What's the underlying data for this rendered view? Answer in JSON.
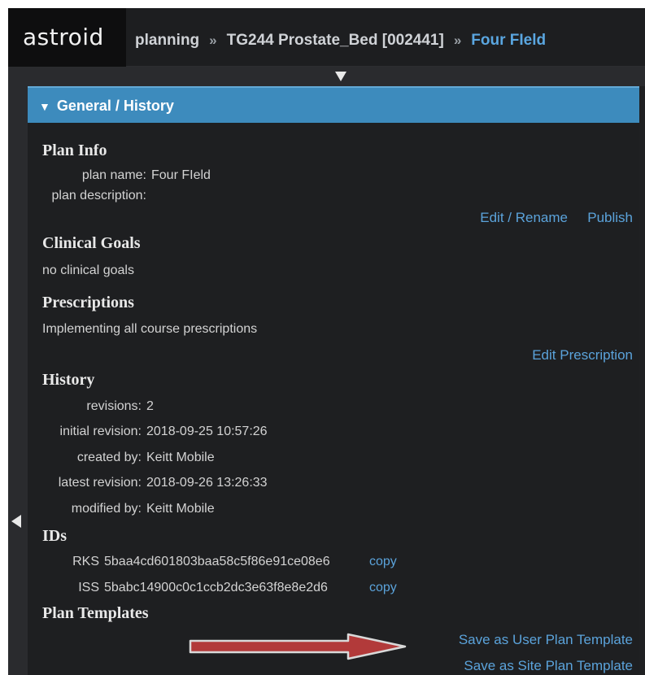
{
  "app": {
    "logo": "astroid"
  },
  "breadcrumb": {
    "items": [
      "planning",
      "TG244 Prostate_Bed [002441]",
      "Four FIeld"
    ],
    "separator": "»"
  },
  "panel": {
    "title": "General / History",
    "plan_info": {
      "heading": "Plan Info",
      "plan_name_label": "plan name:",
      "plan_name_value": "Four FIeld",
      "plan_description_label": "plan description:",
      "edit_rename": "Edit / Rename",
      "publish": "Publish"
    },
    "clinical_goals": {
      "heading": "Clinical Goals",
      "text": "no clinical goals"
    },
    "prescriptions": {
      "heading": "Prescriptions",
      "text": "Implementing all course prescriptions",
      "edit_prescription": "Edit Prescription"
    },
    "history": {
      "heading": "History",
      "revisions_label": "revisions:",
      "revisions_value": "2",
      "initial_label": "initial revision:",
      "initial_value": "2018-09-25 10:57:26",
      "created_label": "created by:",
      "created_value": "Keitt Mobile",
      "latest_label": "latest revision:",
      "latest_value": "2018-09-26 13:26:33",
      "modified_label": "modified by:",
      "modified_value": "Keitt Mobile"
    },
    "ids": {
      "heading": "IDs",
      "rks_label": "RKS",
      "rks_value": "5baa4cd601803baa58c5f86e91ce08e6",
      "iss_label": "ISS",
      "iss_value": "5babc14900c0c1ccb2dc3e63f8e8e2d6",
      "copy": "copy"
    },
    "plan_templates": {
      "heading": "Plan Templates",
      "save_user": "Save as User Plan Template",
      "save_site": "Save as Site Plan Template"
    }
  },
  "colors": {
    "link": "#5ba3db",
    "header_accent": "#3d8bbd",
    "annotation_arrow": "#b23a3a"
  }
}
